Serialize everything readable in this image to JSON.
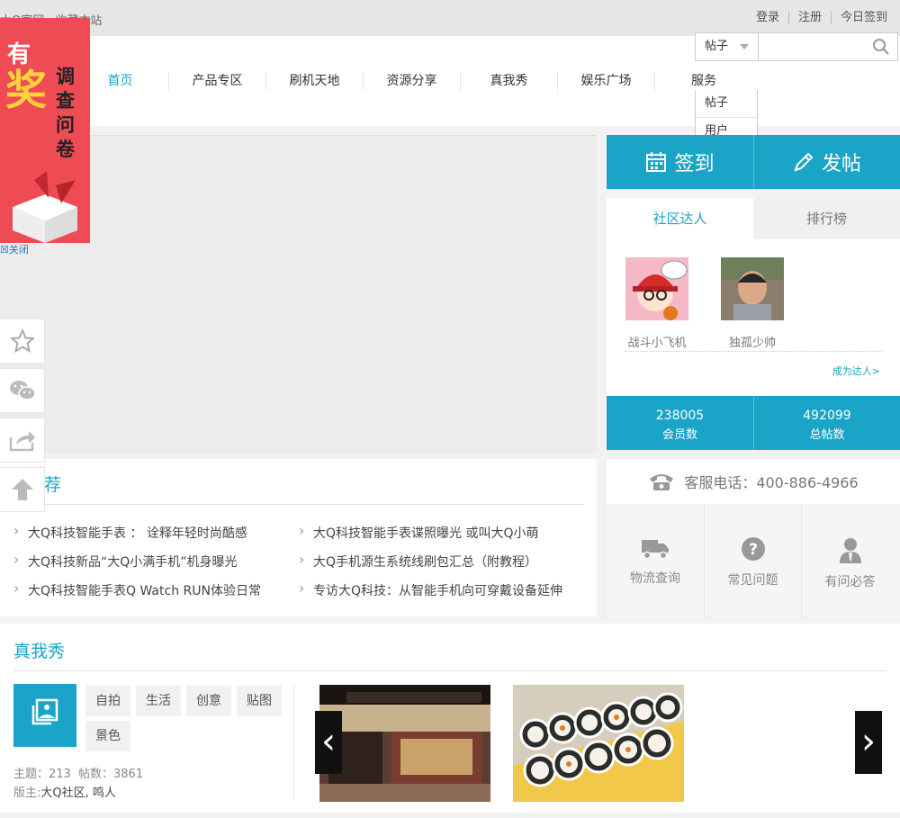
{
  "topbar": {
    "left": [
      "大Q官网",
      "收藏本站"
    ],
    "right": [
      "登录",
      "注册",
      "今日签到"
    ]
  },
  "nav": {
    "items": [
      "首页",
      "产品专区",
      "刷机天地",
      "资源分享",
      "真我秀",
      "娱乐广场",
      "服务"
    ],
    "active_index": 0
  },
  "search": {
    "selected": "帖子",
    "options": [
      "帖子",
      "用户"
    ],
    "placeholder": ""
  },
  "actions": {
    "sign_label": "签到",
    "post_label": "发帖"
  },
  "community": {
    "tabs": [
      "社区达人",
      "排行榜"
    ],
    "users": [
      {
        "name": "战斗小飞机"
      },
      {
        "name": "独孤少帅"
      }
    ],
    "become_link": "成为达人>",
    "stats": [
      {
        "value": "238005",
        "label": "会员数"
      },
      {
        "value": "492099",
        "label": "总帖数"
      }
    ]
  },
  "recommend": {
    "title": "推荐",
    "left": [
      "大Q科技智能手表 ： 诠释年轻时尚酷感",
      "大Q科技新品“大Q小满手机”机身曝光",
      "大Q科技智能手表Q Watch RUN体验日常"
    ],
    "right": [
      "大Q科技智能手表谍照曝光 或叫大Q小萌",
      "大Q手机源生系统线刷包汇总（附教程）",
      "专访大Q科技：从智能手机向可穿戴设备延伸"
    ]
  },
  "service": {
    "phone": "客服电话：400-886-4966",
    "items": [
      "物流查询",
      "常见问题",
      "有问必答"
    ]
  },
  "show": {
    "title": "真我秀",
    "tags": [
      "自拍",
      "生活",
      "创意",
      "贴图",
      "景色"
    ],
    "topics_label": "主题：",
    "topics": "213",
    "posts_label": "帖数：",
    "posts": "3861",
    "moderator_label": "版主:",
    "moderators": "大Q社区, 鸣人"
  },
  "ad": {
    "line1": "有",
    "line2": "奖",
    "line3": "调查问卷",
    "close": "关闭"
  },
  "colors": {
    "accent": "#1aa5c8",
    "ad_bg": "#ee4b55"
  }
}
